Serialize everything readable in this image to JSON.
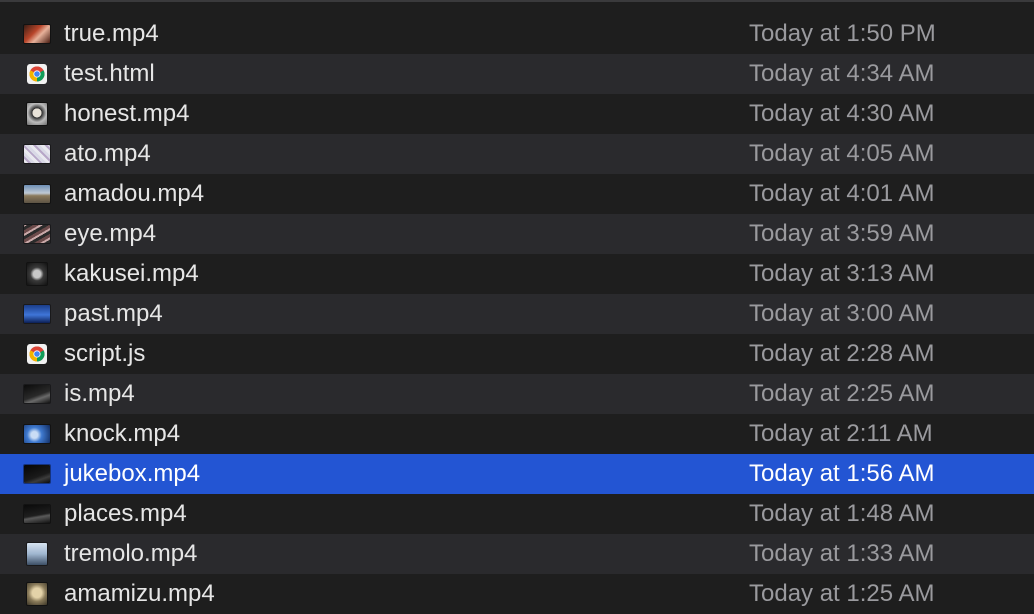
{
  "files": [
    {
      "name": "true.mp4",
      "date": "Today at 1:50 PM",
      "icon": "video-thumbnail-icon",
      "thumb": "t-true",
      "selected": false
    },
    {
      "name": "test.html",
      "date": "Today at 4:34 AM",
      "icon": "chrome-document-icon",
      "thumb": "chrome",
      "selected": false
    },
    {
      "name": "honest.mp4",
      "date": "Today at 4:30 AM",
      "icon": "video-thumbnail-icon",
      "thumb": "t-honest tall",
      "selected": false
    },
    {
      "name": "ato.mp4",
      "date": "Today at 4:05 AM",
      "icon": "video-thumbnail-icon",
      "thumb": "t-ato",
      "selected": false
    },
    {
      "name": "amadou.mp4",
      "date": "Today at 4:01 AM",
      "icon": "video-thumbnail-icon",
      "thumb": "t-amadou",
      "selected": false
    },
    {
      "name": "eye.mp4",
      "date": "Today at 3:59 AM",
      "icon": "video-thumbnail-icon",
      "thumb": "t-eye",
      "selected": false
    },
    {
      "name": "kakusei.mp4",
      "date": "Today at 3:13 AM",
      "icon": "video-thumbnail-icon",
      "thumb": "t-kakusei tall",
      "selected": false
    },
    {
      "name": "past.mp4",
      "date": "Today at 3:00 AM",
      "icon": "video-thumbnail-icon",
      "thumb": "t-past",
      "selected": false
    },
    {
      "name": "script.js",
      "date": "Today at 2:28 AM",
      "icon": "chrome-document-icon",
      "thumb": "chrome",
      "selected": false
    },
    {
      "name": "is.mp4",
      "date": "Today at 2:25 AM",
      "icon": "video-thumbnail-icon",
      "thumb": "t-is",
      "selected": false
    },
    {
      "name": "knock.mp4",
      "date": "Today at 2:11 AM",
      "icon": "video-thumbnail-icon",
      "thumb": "t-knock",
      "selected": false
    },
    {
      "name": "jukebox.mp4",
      "date": "Today at 1:56 AM",
      "icon": "video-thumbnail-icon",
      "thumb": "t-jukebox",
      "selected": true
    },
    {
      "name": "places.mp4",
      "date": "Today at 1:48 AM",
      "icon": "video-thumbnail-icon",
      "thumb": "t-places",
      "selected": false
    },
    {
      "name": "tremolo.mp4",
      "date": "Today at 1:33 AM",
      "icon": "video-thumbnail-icon",
      "thumb": "t-tremolo tall",
      "selected": false
    },
    {
      "name": "amamizu.mp4",
      "date": "Today at 1:25 AM",
      "icon": "video-thumbnail-icon",
      "thumb": "t-amamizu tall",
      "selected": false
    }
  ],
  "colors": {
    "background": "#1e1e1e",
    "stripe": "#2a2a2d",
    "selection": "#2355d3",
    "name_text": "#e6e6e6",
    "date_text": "#9a9a9e"
  }
}
